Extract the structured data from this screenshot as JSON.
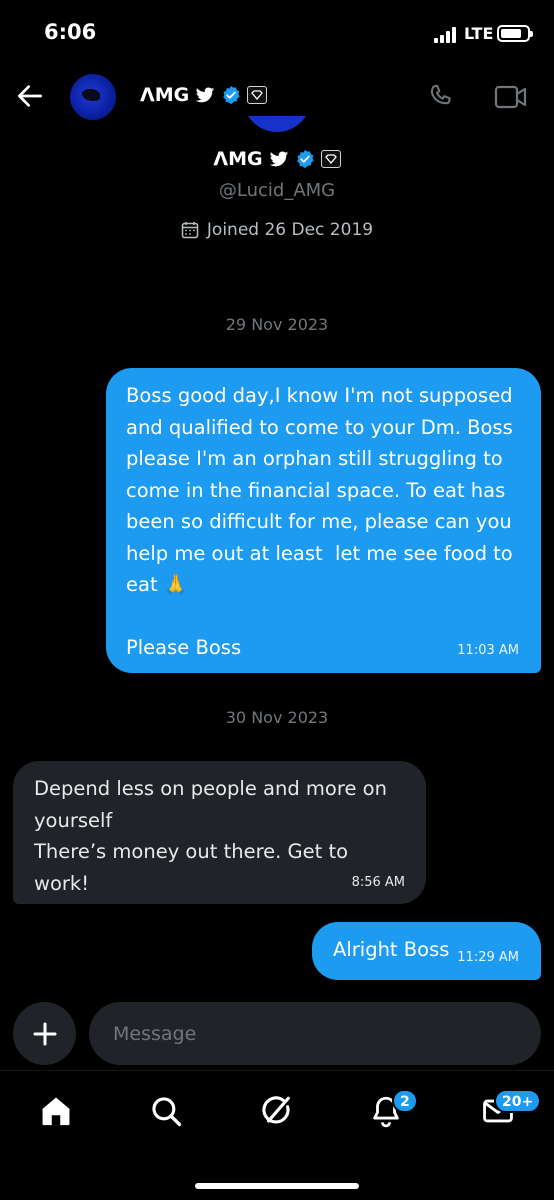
{
  "status_bar": {
    "time": "6:06",
    "network": "LTE",
    "battery_level": 0.8
  },
  "header": {
    "name": "ΛMG"
  },
  "profile": {
    "name": "ΛMG",
    "handle": "@Lucid_AMG",
    "joined": "Joined 26 Dec 2019"
  },
  "messages": {
    "date_1": "29 Nov 2023",
    "msg_1": {
      "text": "Boss good day,I know I'm not supposed and qualified to come to your Dm. Boss please I'm an orphan still struggling to come in the financial space. To eat has been so difficult for me, please can you help me out at least  let me see food to eat 🙏\n\nPlease Boss",
      "time": "11:03 AM"
    },
    "date_2": "30 Nov 2023",
    "msg_2": {
      "text": "Depend less on people and more on yourself\nThere’s money out there. Get to work!",
      "time": "8:56 AM"
    },
    "msg_3": {
      "text": "Alright Boss",
      "time": "11:29 AM"
    }
  },
  "composer": {
    "placeholder": "Message"
  },
  "nav": {
    "notifications_badge": "2",
    "messages_badge": "20+"
  },
  "colors": {
    "accent": "#1d9bf0",
    "background": "#000000",
    "incoming_bubble": "#202327",
    "secondary_text": "#71767b"
  }
}
